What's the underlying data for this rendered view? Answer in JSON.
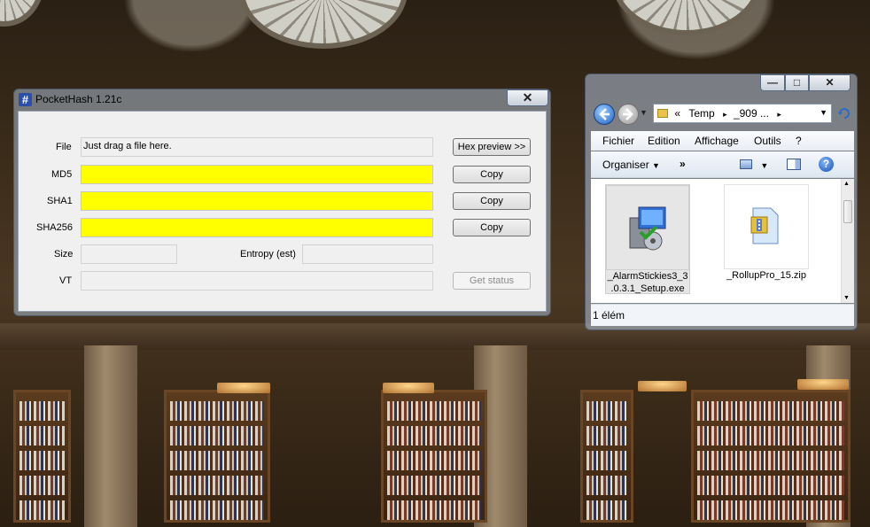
{
  "pockethash": {
    "title": "PocketHash 1.21c",
    "close": "✕",
    "labels": {
      "file": "File",
      "md5": "MD5",
      "sha1": "SHA1",
      "sha256": "SHA256",
      "size": "Size",
      "entropy": "Entropy (est)",
      "vt": "VT"
    },
    "fields": {
      "file": "Just drag a file here.",
      "md5": "",
      "sha1": "",
      "sha256": "",
      "size": "",
      "entropy": "",
      "vt": ""
    },
    "buttons": {
      "hex_preview": "Hex preview >>",
      "copy_md5": "Copy",
      "copy_sha1": "Copy",
      "copy_sha256": "Copy",
      "get_status": "Get status"
    },
    "colors": {
      "hash_field": "#ffff00"
    }
  },
  "explorer": {
    "caption_buttons": {
      "minimize": "—",
      "maximize": "□",
      "close": "✕"
    },
    "address": {
      "prefix": "«",
      "seg1": "Temp",
      "sep": "▸",
      "seg2": "_909 ...",
      "sep2": "▸"
    },
    "menu": [
      "Fichier",
      "Edition",
      "Affichage",
      "Outils",
      "?"
    ],
    "toolbar": {
      "organize": "Organiser",
      "more": "»"
    },
    "files": [
      {
        "name": "_AlarmStickies3_3.0.3.1_Setup.exe",
        "line1": "_AlarmStickies3_3",
        "line2": ".0.3.1_Setup.exe",
        "icon": "installer-icon"
      },
      {
        "name": "_RollupPro_15.zip",
        "line1": "_RollupPro_15.zip",
        "line2": "",
        "icon": "zip-folder-icon"
      }
    ],
    "status": "1 élém"
  }
}
